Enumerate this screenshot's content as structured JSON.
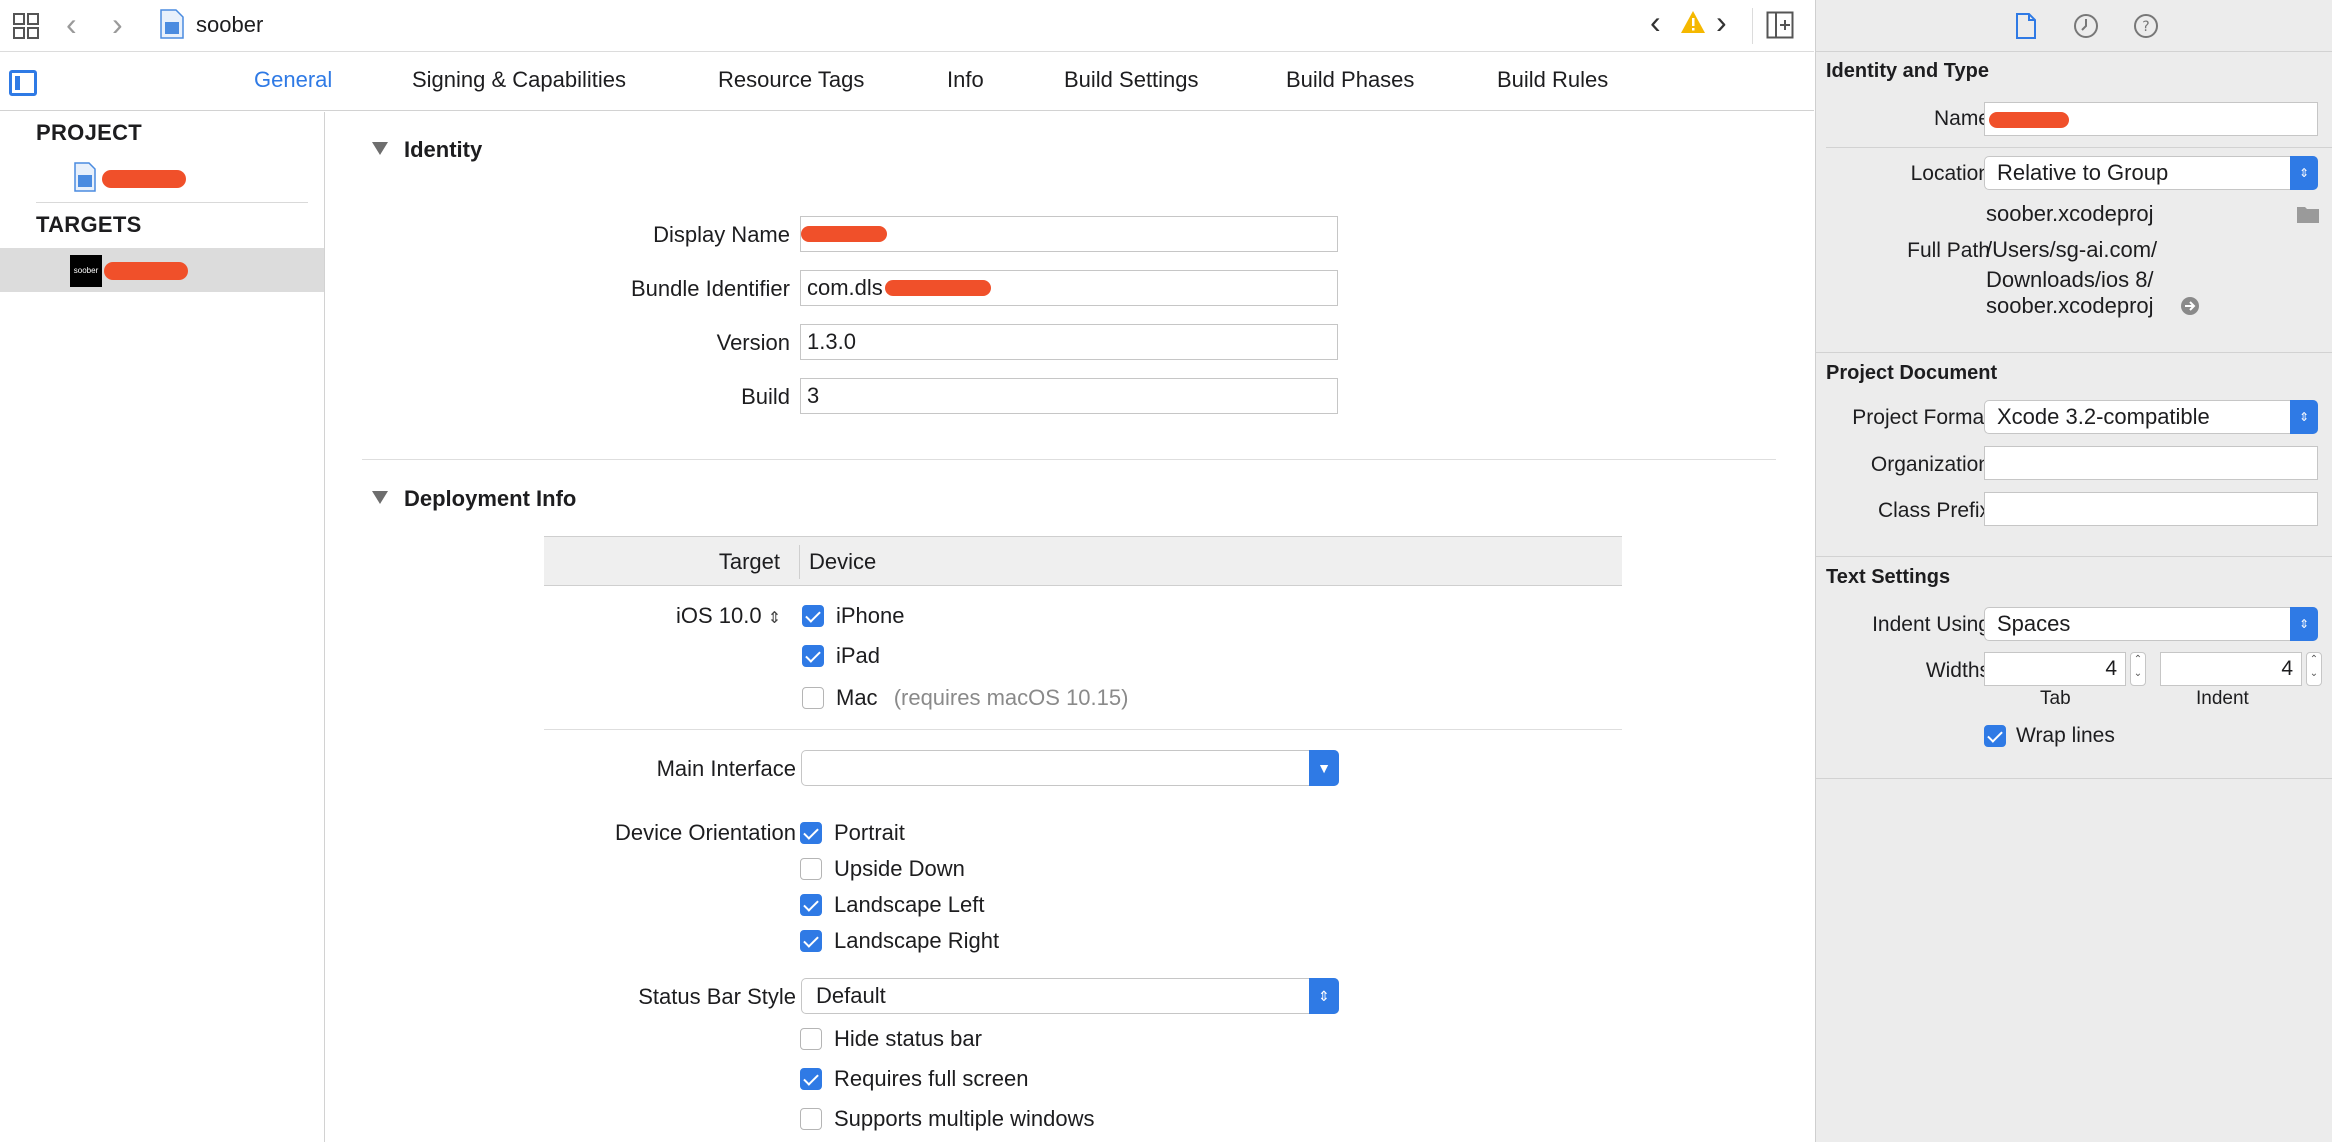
{
  "toolbar": {
    "file_title": "soober",
    "icons": [
      "grid-icon",
      "back-icon",
      "forward-icon",
      "project-file-icon",
      "issue-previous-icon",
      "warning-icon",
      "issue-next-icon",
      "add-editor-icon"
    ]
  },
  "tabs": [
    {
      "label": "General",
      "active": true
    },
    {
      "label": "Signing & Capabilities",
      "active": false
    },
    {
      "label": "Resource Tags",
      "active": false
    },
    {
      "label": "Info",
      "active": false
    },
    {
      "label": "Build Settings",
      "active": false
    },
    {
      "label": "Build Phases",
      "active": false
    },
    {
      "label": "Build Rules",
      "active": false
    }
  ],
  "sidebar": {
    "project_header": "PROJECT",
    "targets_header": "TARGETS",
    "target_icon_text": "soober"
  },
  "identity": {
    "title": "Identity",
    "display_name_label": "Display Name",
    "bundle_id_label": "Bundle Identifier",
    "bundle_id_value": "com.dls",
    "version_label": "Version",
    "version_value": "1.3.0",
    "build_label": "Build",
    "build_value": "3"
  },
  "deployment": {
    "title": "Deployment Info",
    "target_header": "Target",
    "device_header": "Device",
    "ios_version": "iOS 10.0",
    "devices": [
      {
        "label": "iPhone",
        "checked": true
      },
      {
        "label": "iPad",
        "checked": true
      },
      {
        "label": "Mac",
        "checked": false,
        "note": "(requires macOS 10.15)"
      }
    ],
    "main_interface_label": "Main Interface",
    "main_interface_value": "",
    "orientation_label": "Device Orientation",
    "orientations": [
      {
        "label": "Portrait",
        "checked": true
      },
      {
        "label": "Upside Down",
        "checked": false
      },
      {
        "label": "Landscape Left",
        "checked": true
      },
      {
        "label": "Landscape Right",
        "checked": true
      }
    ],
    "status_bar_label": "Status Bar Style",
    "status_bar_value": "Default",
    "status_options": [
      {
        "label": "Hide status bar",
        "checked": false
      },
      {
        "label": "Requires full screen",
        "checked": true
      },
      {
        "label": "Supports multiple windows",
        "checked": false
      }
    ]
  },
  "inspector": {
    "identity_type_title": "Identity and Type",
    "name_label": "Name",
    "location_label": "Location",
    "location_value": "Relative to Group",
    "location_file": "soober.xcodeproj",
    "full_path_label": "Full Path",
    "full_path_line1": "/Users/sg-ai.com/",
    "full_path_line2": "Downloads/ios 8/",
    "full_path_line3": "soober.xcodeproj",
    "project_document_title": "Project Document",
    "project_format_label": "Project Format",
    "project_format_value": "Xcode 3.2-compatible",
    "organization_label": "Organization",
    "organization_value": "",
    "class_prefix_label": "Class Prefix",
    "class_prefix_value": "",
    "text_settings_title": "Text Settings",
    "indent_using_label": "Indent Using",
    "indent_using_value": "Spaces",
    "widths_label": "Widths",
    "tab_width": "4",
    "indent_width": "4",
    "tab_caption": "Tab",
    "indent_caption": "Indent",
    "wrap_lines_label": "Wrap lines",
    "wrap_lines_checked": true
  },
  "colors": {
    "accent": "#2f7ae5",
    "redaction": "#f0502a",
    "warning": "#f5b800"
  }
}
